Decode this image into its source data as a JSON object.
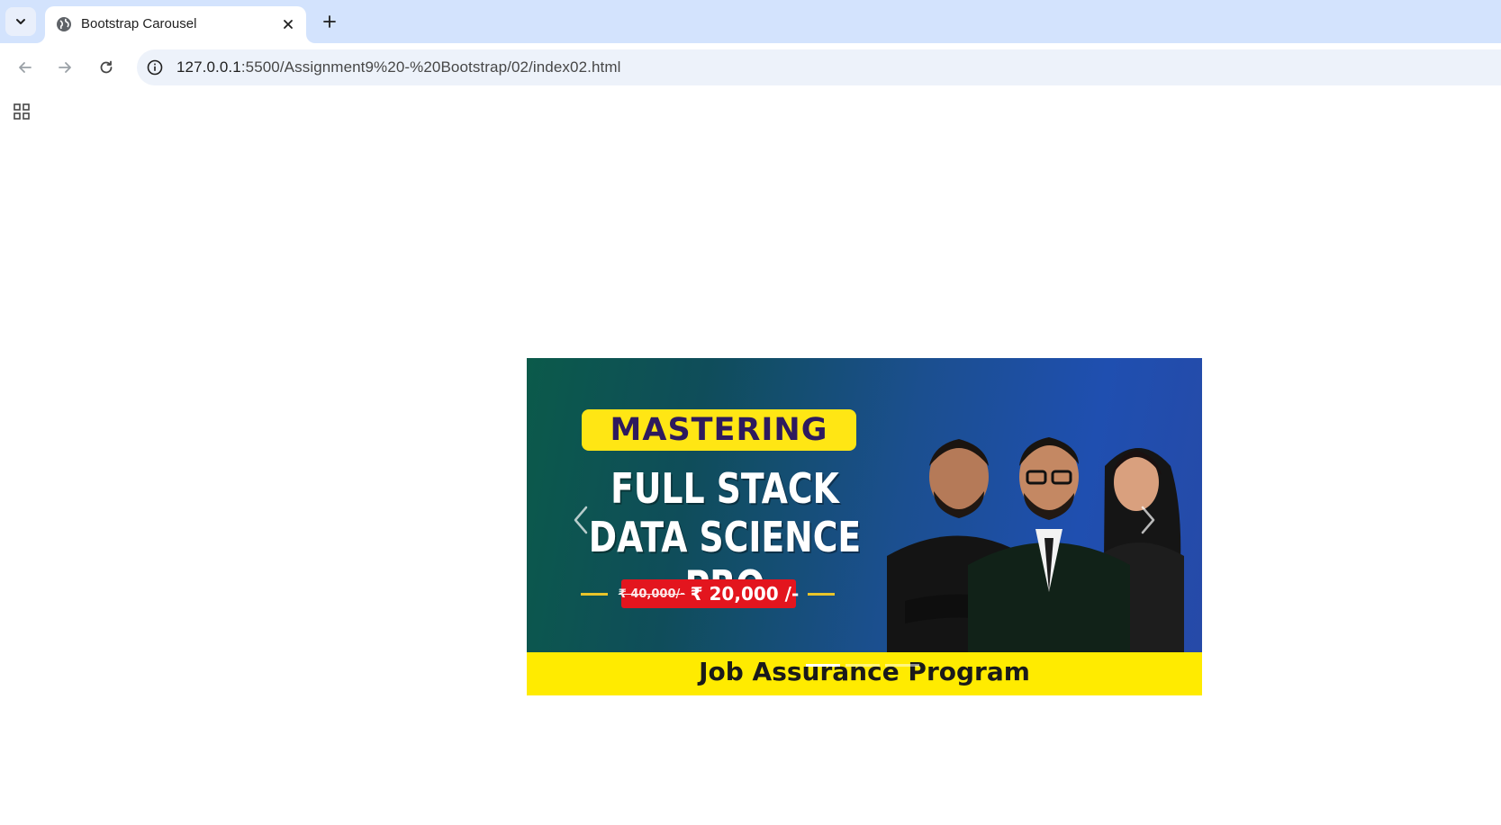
{
  "browser": {
    "tab": {
      "title": "Bootstrap Carousel"
    },
    "address_bar": {
      "host": "127.0.0.1",
      "path": ":5500/Assignment9%20-%20Bootstrap/02/index02.html"
    }
  },
  "carousel": {
    "slide": {
      "badge_text": "MASTERING",
      "headline_line1": "FULL STACK",
      "headline_line2": "DATA SCIENCE PRO",
      "price_old": "₹ 40,000/-",
      "price_new": "₹ 20,000 /-",
      "footer_text": "Job Assurance Program"
    },
    "indicators": [
      {
        "active": true
      },
      {
        "active": false
      },
      {
        "active": false
      }
    ]
  },
  "colors": {
    "tabstrip_bg": "#d3e3fd",
    "omnibox_bg": "#edf2fa",
    "badge_yellow": "#ffe614",
    "price_red": "#e3151e",
    "footer_yellow": "#ffeb00"
  },
  "icons": {
    "tab_search": "chevron-down-icon",
    "favicon": "globe-icon",
    "tab_close": "close-icon",
    "new_tab": "plus-icon",
    "back": "arrow-left-icon",
    "forward": "arrow-right-icon",
    "reload": "reload-icon",
    "site_info": "info-icon",
    "apps": "apps-grid-icon",
    "carousel_prev": "chevron-left-icon",
    "carousel_next": "chevron-right-icon"
  }
}
